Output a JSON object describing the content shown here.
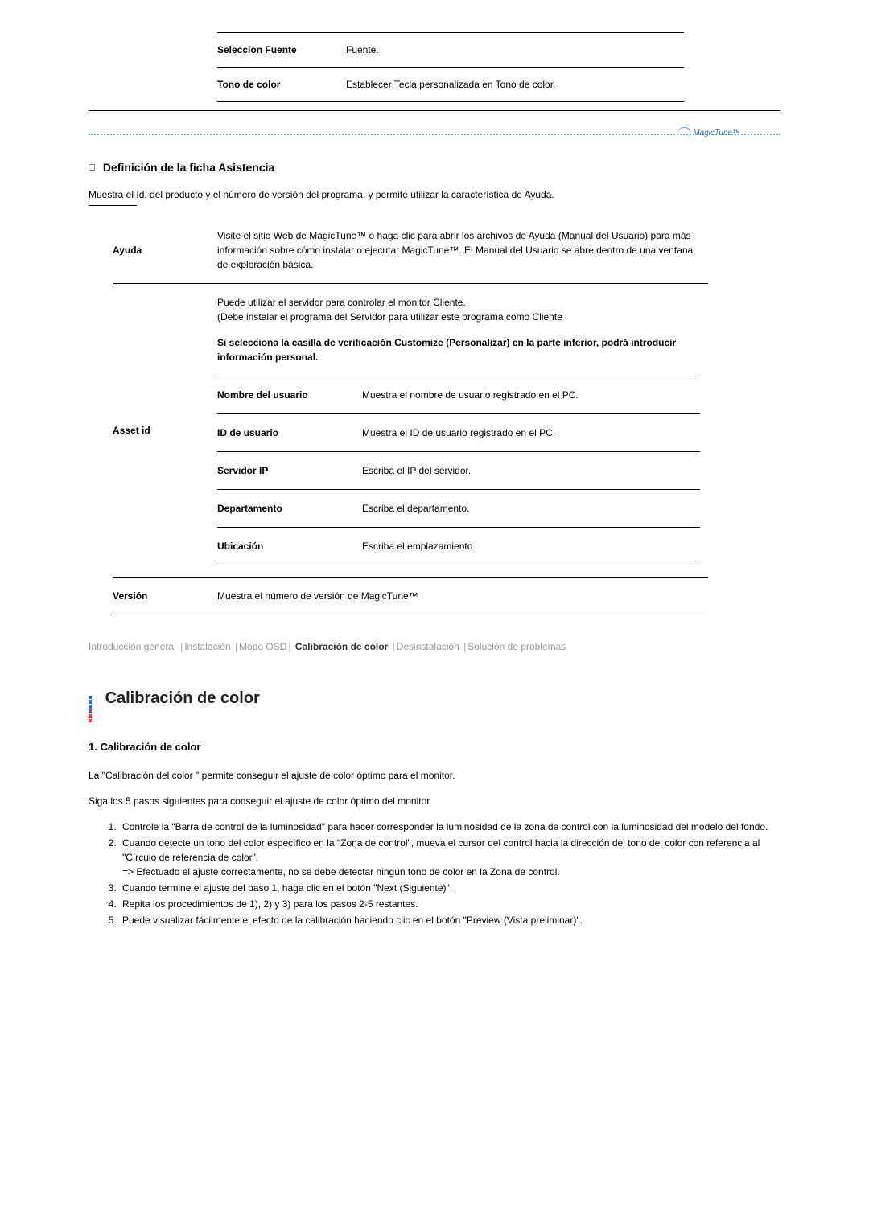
{
  "top_rows": [
    {
      "label": "Seleccion Fuente",
      "desc": "Fuente."
    },
    {
      "label": "Tono de color",
      "desc": "Establecer Tecla personalizada en Tono de color."
    }
  ],
  "logo_text": "MagicTune",
  "section": {
    "title": "Definición de la ficha Asistencia",
    "intro": "Muestra el Id. del producto y el número de versión del programa, y permite utilizar la característica de Ayuda."
  },
  "help": {
    "ayuda_label": "Ayuda",
    "ayuda_desc": "Visite el sitio Web de MagicTune™ o haga clic para abrir los archivos de Ayuda (Manual del Usuario) para más información sobre cómo instalar o ejecutar MagicTune™. El Manual del Usuario se abre dentro de una ventana de exploración básica.",
    "asset_label": "Asset id",
    "asset_desc1": "Puede utilizar el servidor para controlar el monitor Cliente.\n(Debe instalar el programa del Servidor para utilizar este programa como Cliente",
    "asset_desc2": "Si selecciona la casilla de verificación Customize (Personalizar) en la parte inferior, podrá introducir información personal.",
    "rows": [
      {
        "label": "Nombre del usuario",
        "desc": "Muestra el nombre de usuario registrado en el PC."
      },
      {
        "label": "ID de usuario",
        "desc": "Muestra el ID de usuario registrado en el PC."
      },
      {
        "label": "Servidor IP",
        "desc": "Escriba el IP del servidor."
      },
      {
        "label": "Departamento",
        "desc": "Escriba el departamento."
      },
      {
        "label": "Ubicación",
        "desc": "Escriba el emplazamiento"
      }
    ],
    "version_label": "Versión",
    "version_desc": "Muestra el número de versión de MagicTune™"
  },
  "nav": {
    "items": [
      "Introducción general",
      "Instalación",
      "Modo OSD",
      "Calibración de color",
      "Desinstalación",
      "Solución de problemas"
    ],
    "current_index": 3
  },
  "calib": {
    "big_title": "Calibración de color",
    "sub_title": "1. Calibración de color",
    "p1": "La \"Calibración del color \" permite conseguir el ajuste de color óptimo para el monitor.",
    "p2": "Siga los 5 pasos siguientes para conseguir el ajuste de color óptimo del monitor.",
    "steps": [
      "Controle la \"Barra de control de la luminosidad\" para hacer corresponder la luminosidad de la zona de control con la luminosidad del modelo del fondo.",
      "Cuando detecte un tono del color específico en la \"Zona de control\", mueva el cursor del control hacia la dirección del tono del color con referencia al \"Círculo de referencia de color\".\n=> Efectuado el ajuste correctamente, no se debe detectar ningún tono de color en la Zona de control.",
      "Cuando termine el ajuste del paso 1, haga clic en el botón \"Next (Siguiente)\".",
      "Repita los procedimientos de 1), 2) y 3) para los pasos 2-5 restantes.",
      "Puede visualizar fácilmente el efecto de la calibración haciendo clic en el botón \"Preview (Vista preliminar)\"."
    ]
  }
}
